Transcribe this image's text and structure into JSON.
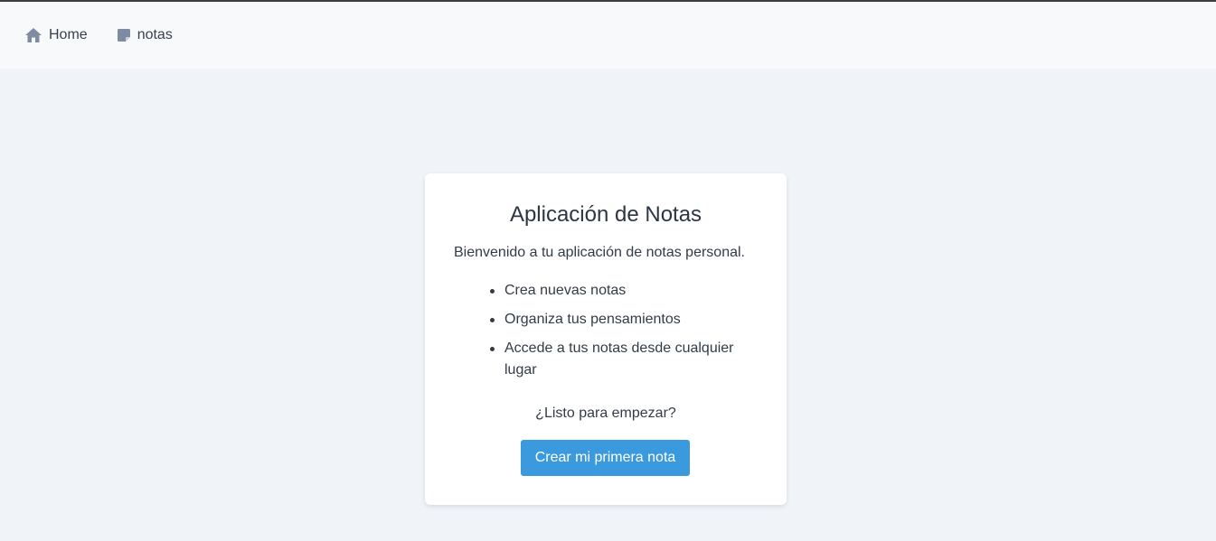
{
  "nav": {
    "items": [
      {
        "label": "Home",
        "icon": "home-icon"
      },
      {
        "label": "notas",
        "icon": "note-icon"
      }
    ]
  },
  "card": {
    "title": "Aplicación de Notas",
    "welcome": "Bienvenido a tu aplicación de notas personal.",
    "features": [
      "Crea nuevas notas",
      "Organiza tus pensamientos",
      "Accede a tus notas desde cualquier lugar"
    ],
    "ready": "¿Listo para empezar?",
    "cta_label": "Crear mi primera nota"
  },
  "colors": {
    "accent": "#3b9ade",
    "icon": "#7e8ba0",
    "background": "#f0f3f7"
  }
}
